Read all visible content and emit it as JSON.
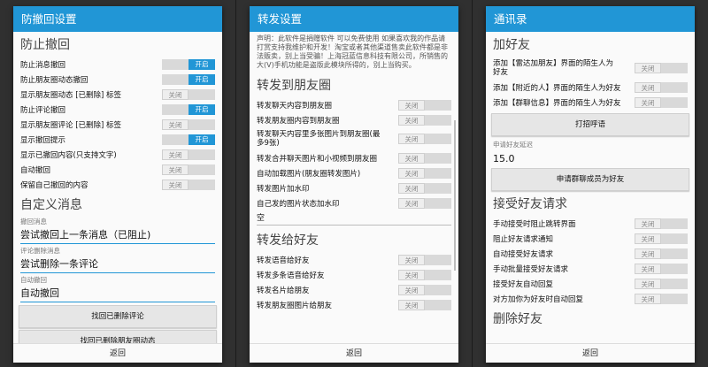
{
  "screens": [
    {
      "title": "防撤回设置",
      "sections": [
        {
          "header": "防止撤回",
          "rows": [
            {
              "label": "防止消息撤回",
              "state": "开启"
            },
            {
              "label": "防止朋友圈动态撤回",
              "state": "开启"
            },
            {
              "label": "显示朋友圈动态 [已删除] 标签",
              "state": "关闭"
            },
            {
              "label": "防止评论撤回",
              "state": "开启"
            },
            {
              "label": "显示朋友圈评论 [已删除] 标签",
              "state": "关闭"
            },
            {
              "label": "显示撤回提示",
              "state": "开启"
            },
            {
              "label": "显示已撤回内容(只支持文字)",
              "state": "关闭"
            },
            {
              "label": "自动撤回",
              "state": "关闭"
            },
            {
              "label": "保留自己撤回的内容",
              "state": "关闭"
            }
          ]
        },
        {
          "header": "自定义消息",
          "fields": [
            {
              "label": "撤回消息",
              "value": "尝试撤回上一条消息（已阻止)"
            },
            {
              "label": "评论删除消息",
              "value": "尝试删除一条评论"
            },
            {
              "label": "自动撤回",
              "value": "自动撤回"
            }
          ]
        }
      ],
      "buttons": [
        "找回已删除评论",
        "找回已删除朋友圈动态"
      ],
      "footer": "返回"
    },
    {
      "title": "转发设置",
      "notice": "声明：此软件是捐赠软件 可以免费使用 如果喜欢我的作品请打赏支持我维护和开发！淘宝或者其他渠道售卖此软件都是非法贩卖，别上当受骗！上海冠蓝信息科技有限公司，所销售的大(V)手机功能是盗版此模块所得的，别上当购买。",
      "sections": [
        {
          "header": "转发到朋友圈",
          "rows": [
            {
              "label": "转发聊天内容到朋友圈",
              "state": "关闭"
            },
            {
              "label": "转发朋友圈内容到朋友圈",
              "state": "关闭"
            },
            {
              "label": "转发聊天内容里多张图片到朋友圈(最多9张)",
              "state": "关闭",
              "tall": true
            },
            {
              "label": "转发合并聊天图片和小视频到朋友圈",
              "state": "关闭"
            },
            {
              "label": "自动加载图片(朋友圈转发图片)",
              "state": "关闭"
            },
            {
              "label": "转发图片加水印",
              "state": "关闭"
            },
            {
              "label": "自己发的图片状态加水印",
              "state": "关闭"
            }
          ],
          "value": "空"
        },
        {
          "header": "转发给好友",
          "rows": [
            {
              "label": "转发语音给好友",
              "state": "关闭"
            },
            {
              "label": "转发多条语音给好友",
              "state": "关闭"
            },
            {
              "label": "转发名片给朋友",
              "state": "关闭"
            },
            {
              "label": "转发朋友圈图片给朋友",
              "state": "关闭"
            }
          ]
        }
      ],
      "footer": "返回"
    },
    {
      "title": "通讯录",
      "sections": [
        {
          "header": "加好友",
          "rows": [
            {
              "label": "添加【雷达加朋友】界面的陌生人为好友",
              "state": "关闭",
              "tall": true
            },
            {
              "label": "添加【附近的人】界面的陌生人为好友",
              "state": "关闭"
            },
            {
              "label": "添加【群聊信息】界面的陌生人为好友",
              "state": "关闭"
            }
          ]
        }
      ],
      "call_button": "打招呼语",
      "delay_label": "申请好友延迟",
      "delay_value": "15.0",
      "group_button": "申请群聊成员为好友",
      "accept_header": "接受好友请求",
      "accept_rows": [
        {
          "label": "手动接受时阻止跳转界面",
          "state": "关闭"
        },
        {
          "label": "阻止好友请求通知",
          "state": "关闭"
        },
        {
          "label": "自动接受好友请求",
          "state": "关闭"
        },
        {
          "label": "手动批量接受好友请求",
          "state": "关闭"
        },
        {
          "label": "接受好友自动回复",
          "state": "关闭"
        },
        {
          "label": "对方加你为好友时自动回复",
          "state": "关闭"
        }
      ],
      "delete_header": "删除好友",
      "footer": "返回"
    }
  ],
  "colors": {
    "accent": "#2196d6",
    "dialog_bg": "#fafafa",
    "backdrop": "#303030"
  }
}
